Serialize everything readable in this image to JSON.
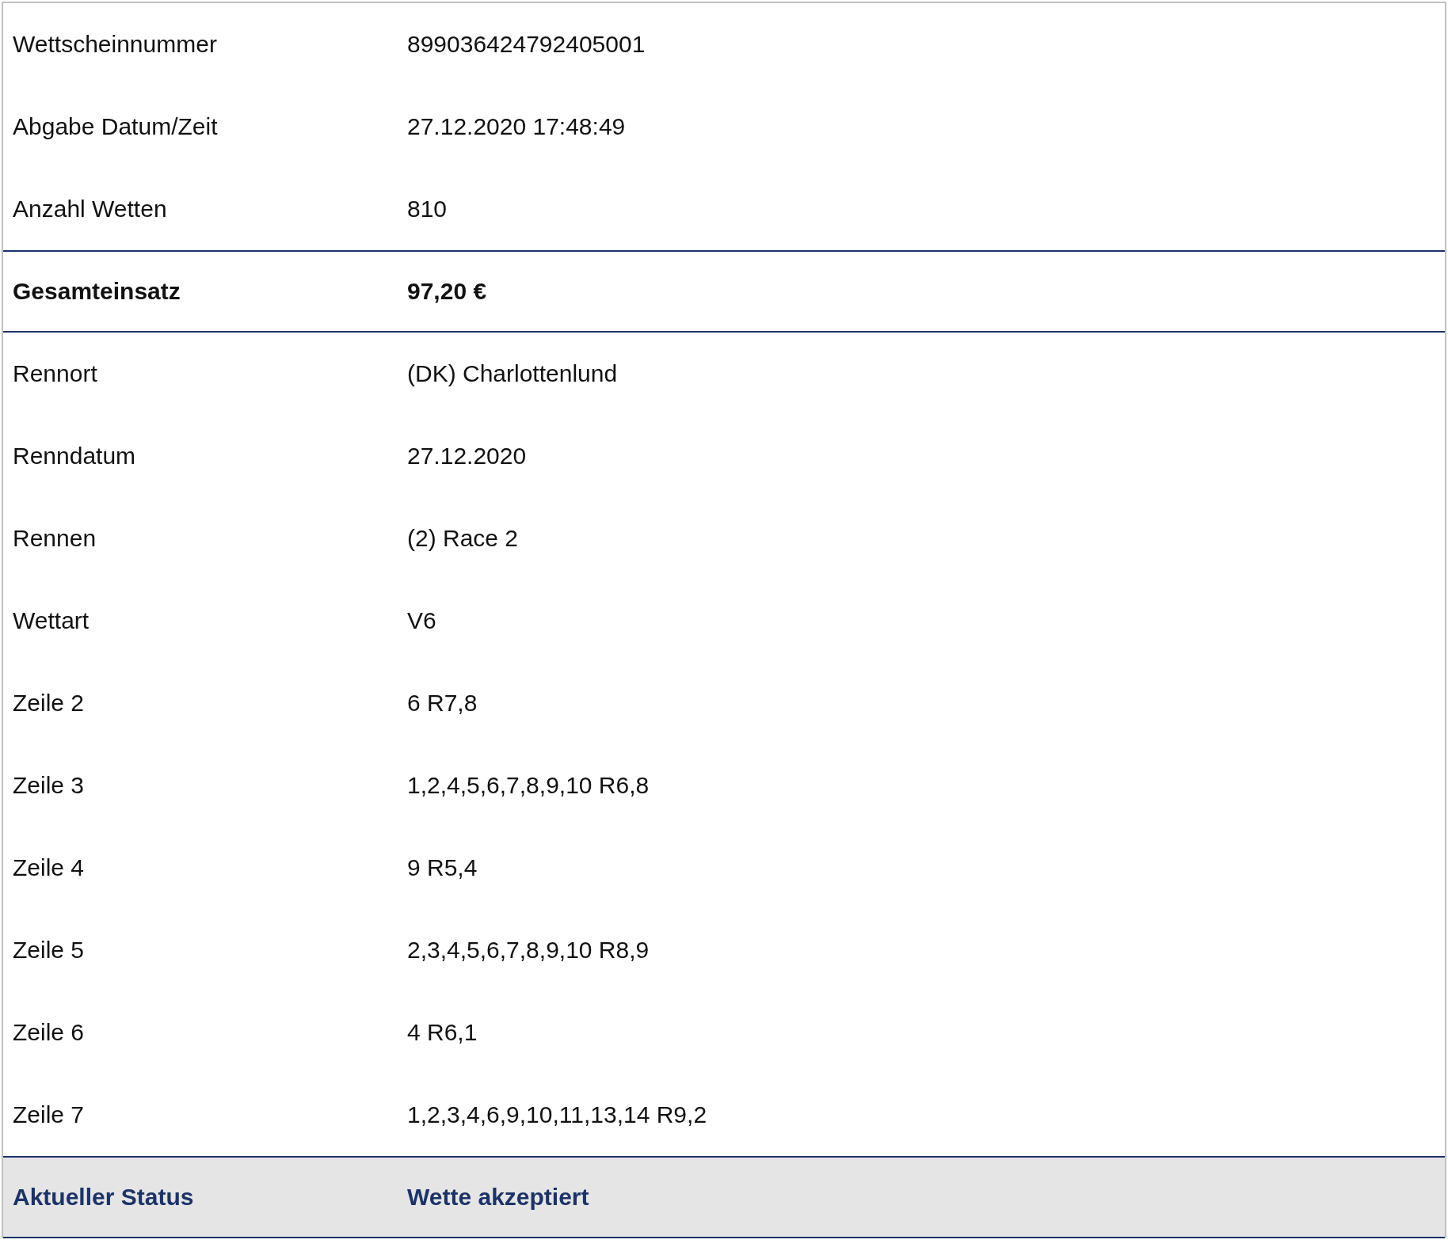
{
  "rows": [
    {
      "kind": "normal",
      "label": "Wettscheinnummer",
      "value": "899036424792405001"
    },
    {
      "kind": "normal",
      "label": "Abgabe Datum/Zeit",
      "value": "27.12.2020 17:48:49"
    },
    {
      "kind": "normal",
      "label": "Anzahl Wetten",
      "value": "810"
    },
    {
      "kind": "total",
      "label": "Gesamteinsatz",
      "value": "97,20 €"
    },
    {
      "kind": "normal",
      "label": "Rennort",
      "value": "(DK) Charlottenlund"
    },
    {
      "kind": "normal",
      "label": "Renndatum",
      "value": "27.12.2020"
    },
    {
      "kind": "normal",
      "label": "Rennen",
      "value": "(2) Race 2"
    },
    {
      "kind": "normal",
      "label": "Wettart",
      "value": "V6"
    },
    {
      "kind": "normal",
      "label": "Zeile 2",
      "value": "6 R7,8"
    },
    {
      "kind": "normal",
      "label": "Zeile 3",
      "value": "1,2,4,5,6,7,8,9,10 R6,8"
    },
    {
      "kind": "normal",
      "label": "Zeile 4",
      "value": "9 R5,4"
    },
    {
      "kind": "normal",
      "label": "Zeile 5",
      "value": "2,3,4,5,6,7,8,9,10 R8,9"
    },
    {
      "kind": "normal",
      "label": "Zeile 6",
      "value": "4 R6,1"
    },
    {
      "kind": "normal",
      "label": "Zeile 7",
      "value": "1,2,3,4,6,9,10,11,13,14 R9,2"
    },
    {
      "kind": "status",
      "label": "Aktueller Status",
      "value": "Wette akzeptiert"
    }
  ]
}
